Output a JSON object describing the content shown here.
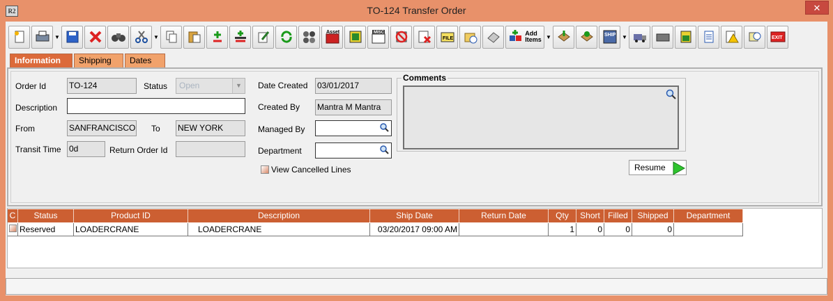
{
  "window": {
    "title": "TO-124 Transfer Order",
    "app_icon_label": "R2",
    "close_glyph": "✕"
  },
  "toolbar": {
    "add_items_label_1": "Add",
    "add_items_label_2": "Items",
    "asset_label": "Asset",
    "misc_label": "MISC",
    "file_label": "FILE",
    "ship_label": "SHIP",
    "exit_label": "EXIT"
  },
  "tabs": [
    "Information",
    "Shipping",
    "Dates"
  ],
  "form": {
    "order_id_label": "Order Id",
    "order_id": "TO-124",
    "status_label": "Status",
    "status": "Open",
    "date_created_label": "Date Created",
    "date_created": "03/01/2017",
    "description_label": "Description",
    "description": "",
    "created_by_label": "Created By",
    "created_by": "Mantra M Mantra",
    "from_label": "From",
    "from": "SANFRANCISCO",
    "to_label": "To",
    "to": "NEW YORK",
    "managed_by_label": "Managed By",
    "managed_by": "",
    "transit_time_label": "Transit Time",
    "transit_time": "0d",
    "return_order_id_label": "Return Order Id",
    "return_order_id": "",
    "department_label": "Department",
    "department": "",
    "view_cancelled_label": "View Cancelled Lines",
    "comments_label": "Comments",
    "resume_label": "Resume"
  },
  "grid": {
    "headers": [
      "C",
      "Status",
      "Product ID",
      "Description",
      "Ship Date",
      "Return Date",
      "Qty",
      "Short",
      "Filled",
      "Shipped",
      "Department"
    ],
    "rows": [
      {
        "status": "Reserved",
        "product_id": "LOADERCRANE",
        "description": "LOADERCRANE",
        "ship_date": "03/20/2017 09:00 AM",
        "return_date": "",
        "qty": "1",
        "short": "0",
        "filled": "0",
        "shipped": "0",
        "department": ""
      }
    ]
  },
  "colors": {
    "accent": "#e8916a",
    "header": "#cc5f32",
    "active_tab": "#dc6a3a",
    "tab": "#f1a26b"
  }
}
